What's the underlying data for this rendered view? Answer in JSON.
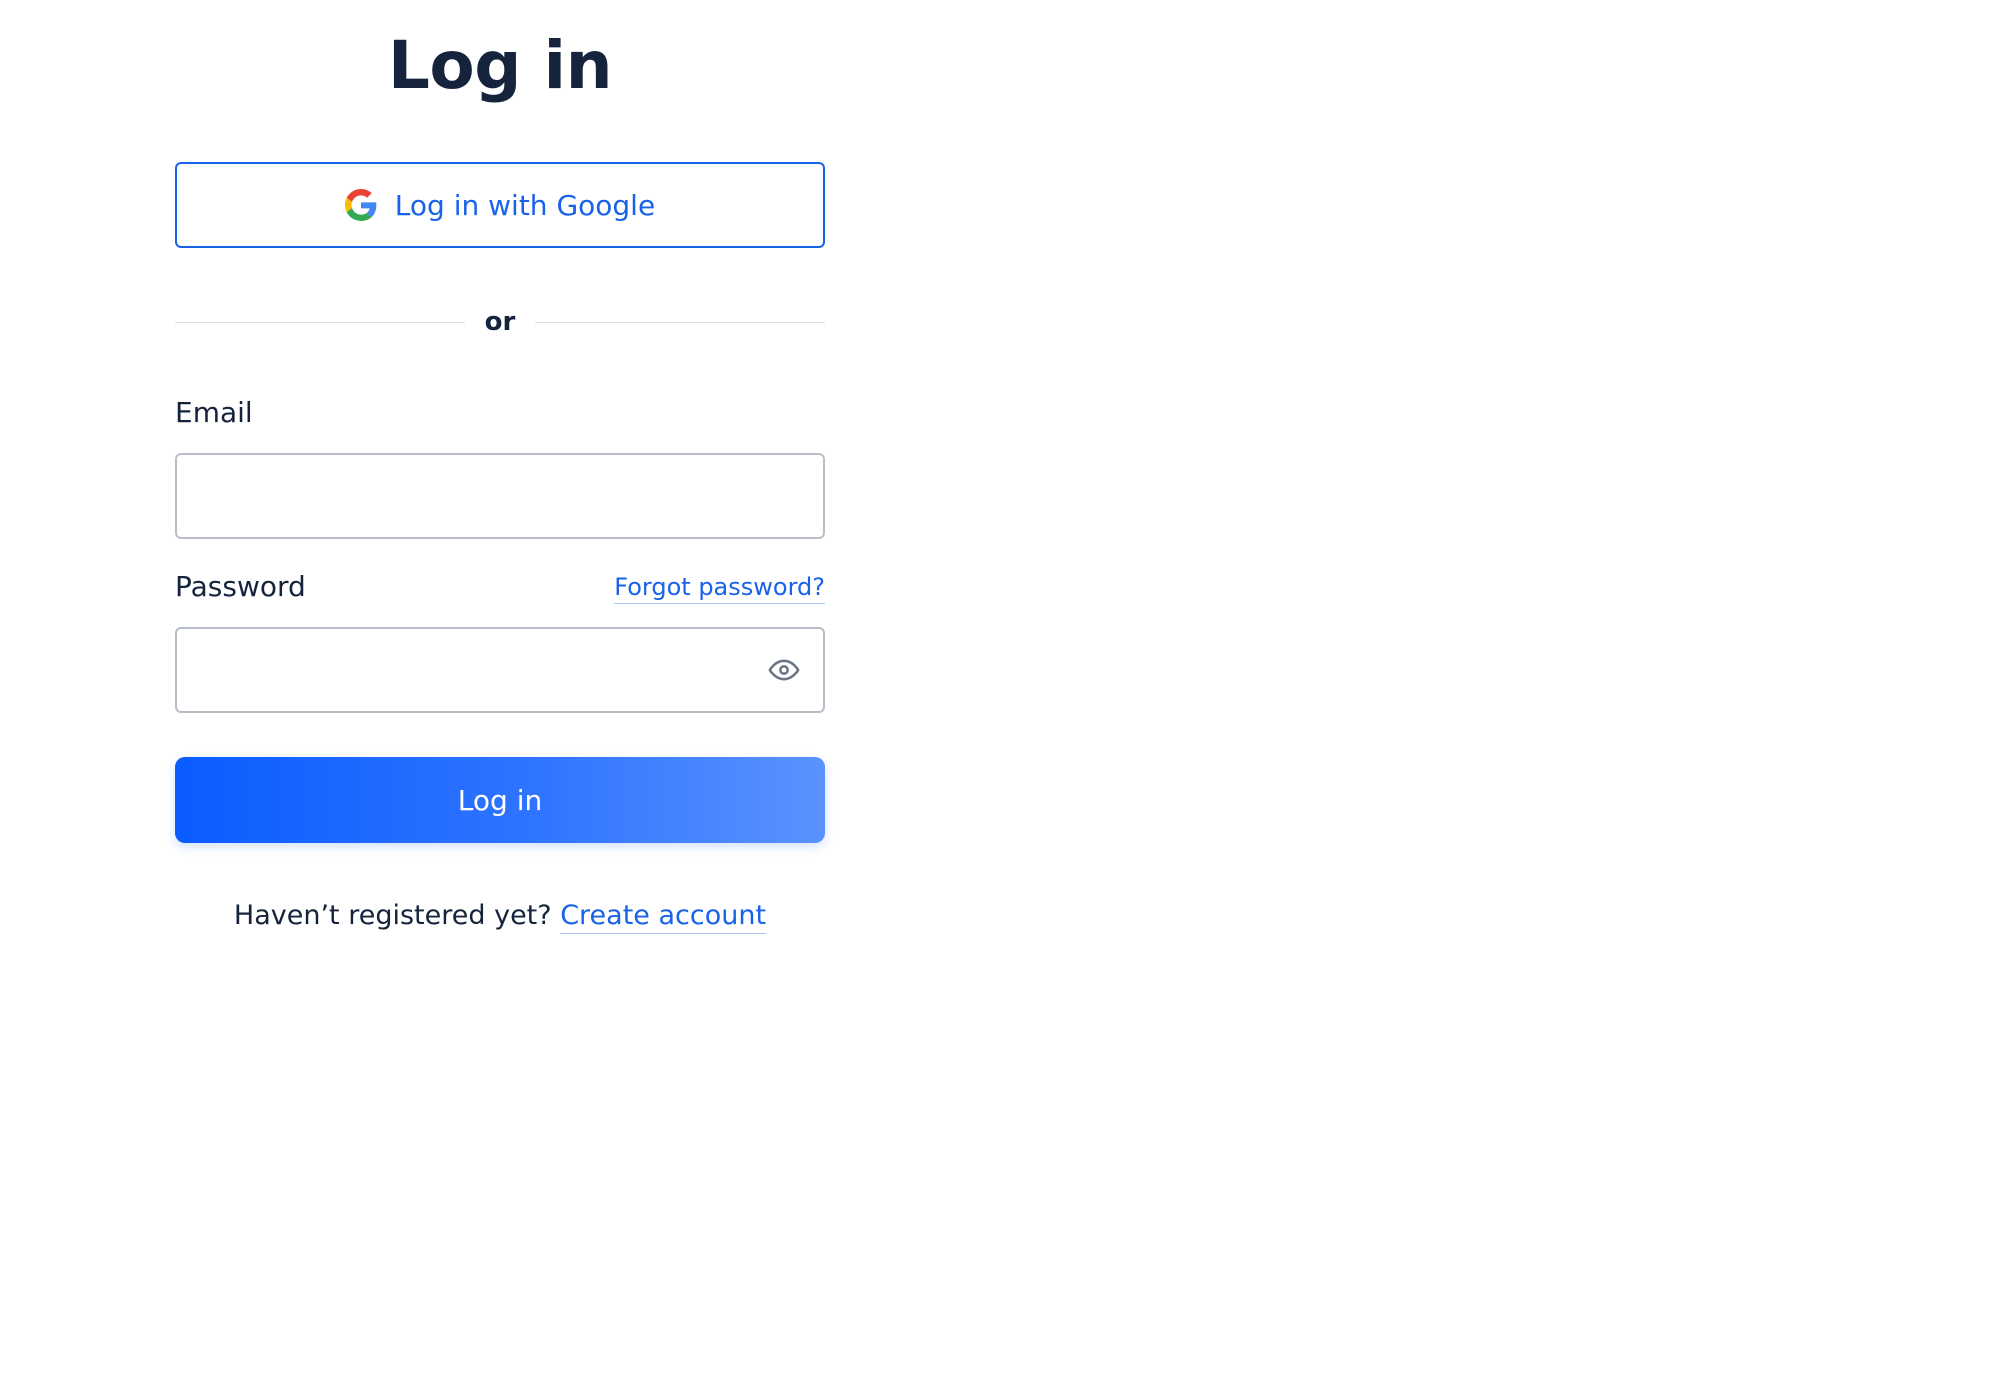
{
  "page": {
    "title": "Log in"
  },
  "google_button": {
    "label": "Log in with Google",
    "icon": "google-g-icon"
  },
  "divider": {
    "label": "or"
  },
  "email": {
    "label": "Email",
    "value": "",
    "placeholder": ""
  },
  "password": {
    "label": "Password",
    "value": "",
    "placeholder": "",
    "forgot_label": "Forgot password?",
    "toggle_icon": "eye-icon"
  },
  "submit": {
    "label": "Log in"
  },
  "register": {
    "prompt": "Haven’t registered yet?",
    "link_label": "Create account"
  },
  "colors": {
    "accent": "#1a62ea",
    "heading": "#15233c",
    "button_gradient_start": "#0a5cff",
    "button_gradient_end": "#5a93ff",
    "input_border": "#b7bec8"
  }
}
